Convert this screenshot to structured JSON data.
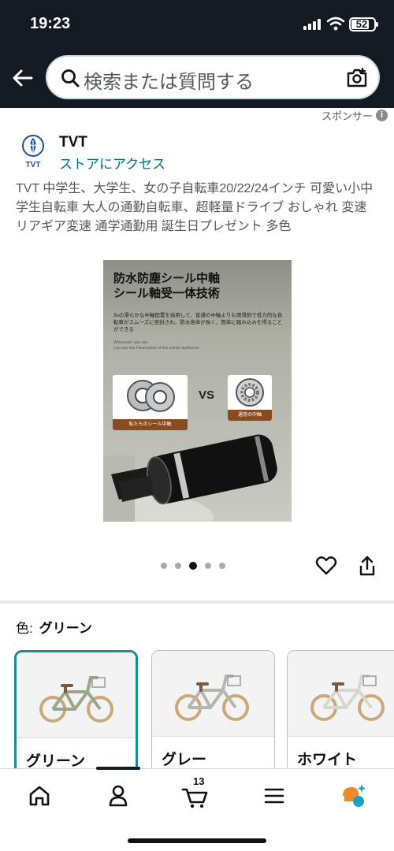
{
  "status_bar": {
    "time": "19:23",
    "battery": "52"
  },
  "search": {
    "placeholder": "検索または質問する"
  },
  "sponsored": {
    "label": "スポンサー",
    "info_glyph": "i"
  },
  "brand": {
    "name": "TVT",
    "logo_text": "TVT",
    "store_link": "ストアにアクセス"
  },
  "product": {
    "title": "TVT 中学生、大学生、女の子自転車20/22/24インチ 可愛い小中学生自転車 大人の通勤自転車、超軽量ドライブ おしゃれ 変速 リアギア変速 通学通勤用 誕生日プレゼント 多色",
    "image": {
      "heading_line1": "防水防塵シール中軸",
      "heading_line2": "シール軸受一体技術",
      "description": "3sの滑らかな中軸配置を採用して、普通の中軸よりも潤滑剤で低力的な自転車がスムーズに密封され、防水寿命が長く、簡単に踏み込みを得ることができる",
      "english_line1": "Wherever you are",
      "english_line2": "you are the focal point of the entire audience",
      "vs_label": "VS",
      "left_card_label": "私たちのシール中軸",
      "right_card_label": "通常の中軸"
    },
    "carousel": {
      "total": 5,
      "active_index": 2
    }
  },
  "color_selector": {
    "label": "色:",
    "selected": "グリーン",
    "options": [
      {
        "name": "グリーン",
        "frame_color": "#9aa58c"
      },
      {
        "name": "グレー",
        "frame_color": "#b7b5b0"
      },
      {
        "name": "ホワイト",
        "frame_color": "#e2e0da"
      }
    ]
  },
  "bottom_nav": {
    "items": [
      "home-icon",
      "account-icon",
      "cart-icon",
      "menu-icon",
      "assistant-icon"
    ],
    "cart_count": "13"
  },
  "colors": {
    "header_bg": "#131a22",
    "link": "#007185",
    "selected_border": "#1e8a9a",
    "assistant_orange": "#f08a24",
    "assistant_teal": "#1aa3c8"
  }
}
